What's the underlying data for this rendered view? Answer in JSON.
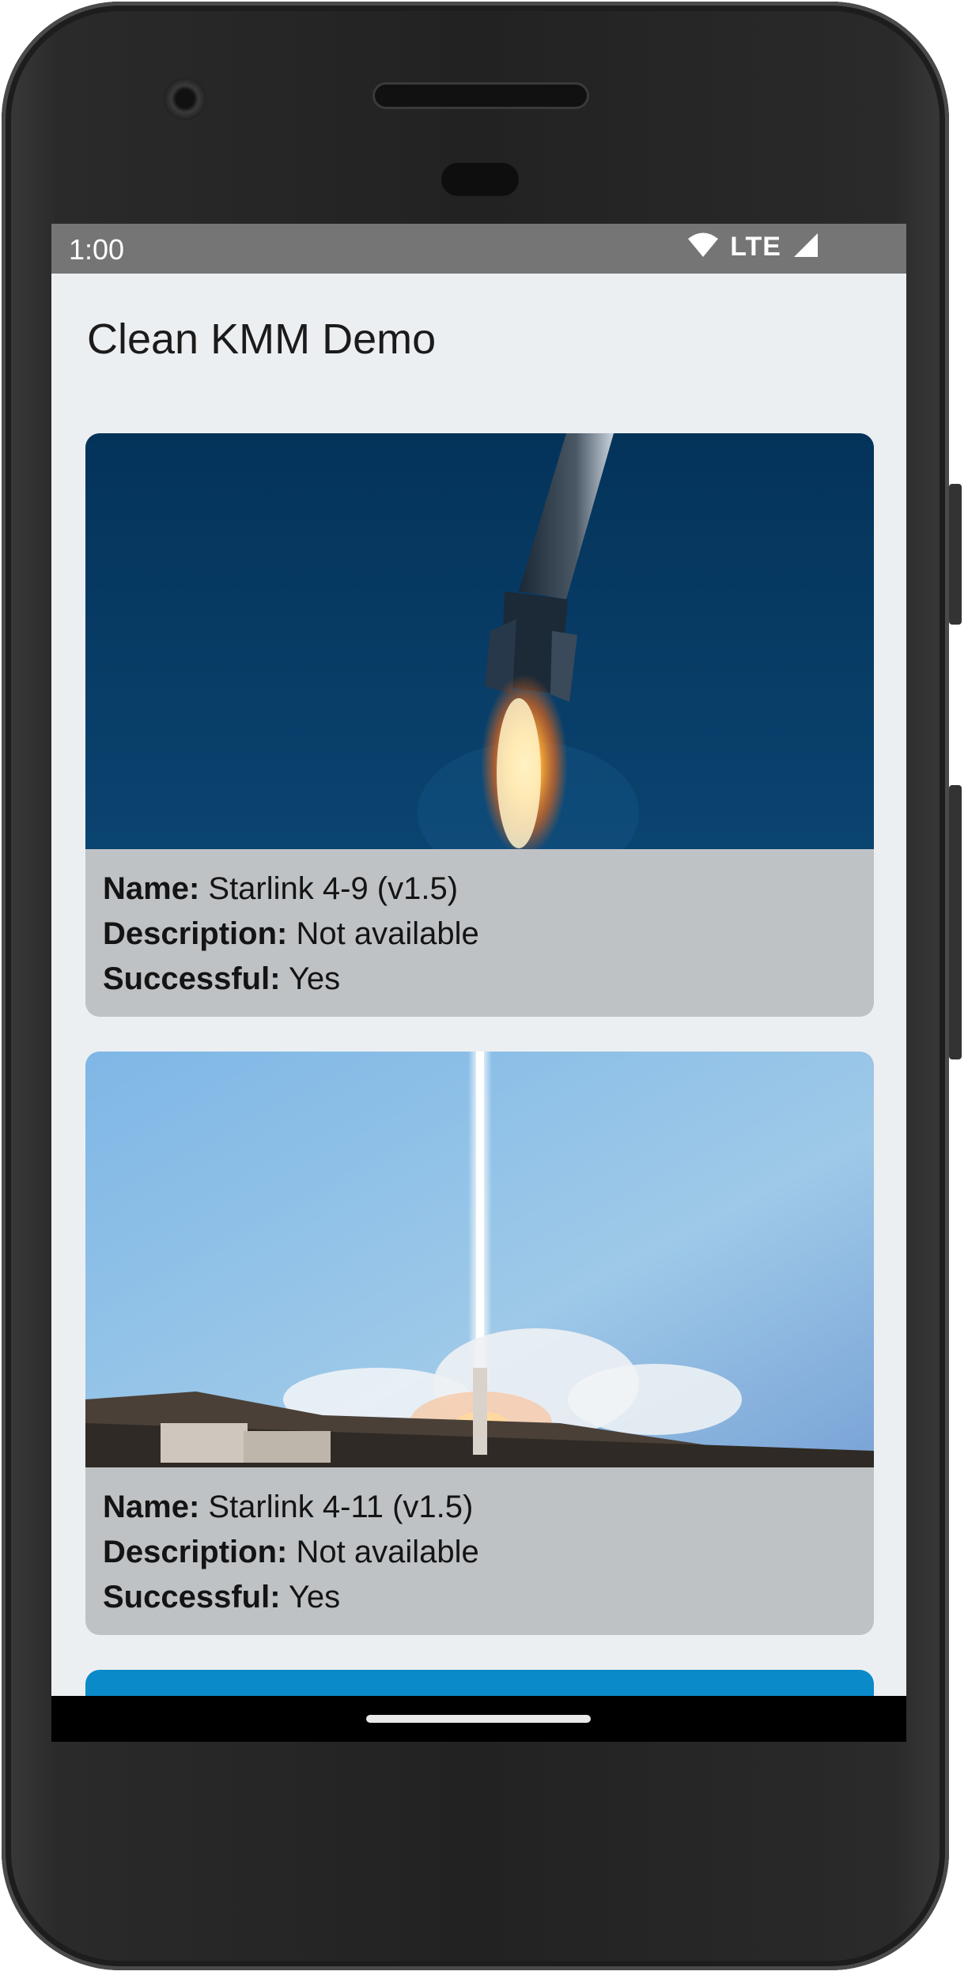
{
  "status_bar": {
    "time": "1:00",
    "network": "LTE",
    "icons": [
      "wifi-icon",
      "cell-signal-icon"
    ]
  },
  "app": {
    "title": "Clean KMM Demo"
  },
  "labels": {
    "name": "Name:",
    "description": "Description:",
    "successful": "Successful:"
  },
  "launches": [
    {
      "name": "Starlink 4-9 (v1.5)",
      "description": "Not available",
      "successful": "Yes"
    },
    {
      "name": "Starlink 4-11 (v1.5)",
      "description": "Not available",
      "successful": "Yes"
    }
  ],
  "colors": {
    "screen_background": "#eceff1",
    "status_bar": "#757575",
    "card_background": "#bfc2c5",
    "next_card_accent": "#0a8ac9"
  }
}
